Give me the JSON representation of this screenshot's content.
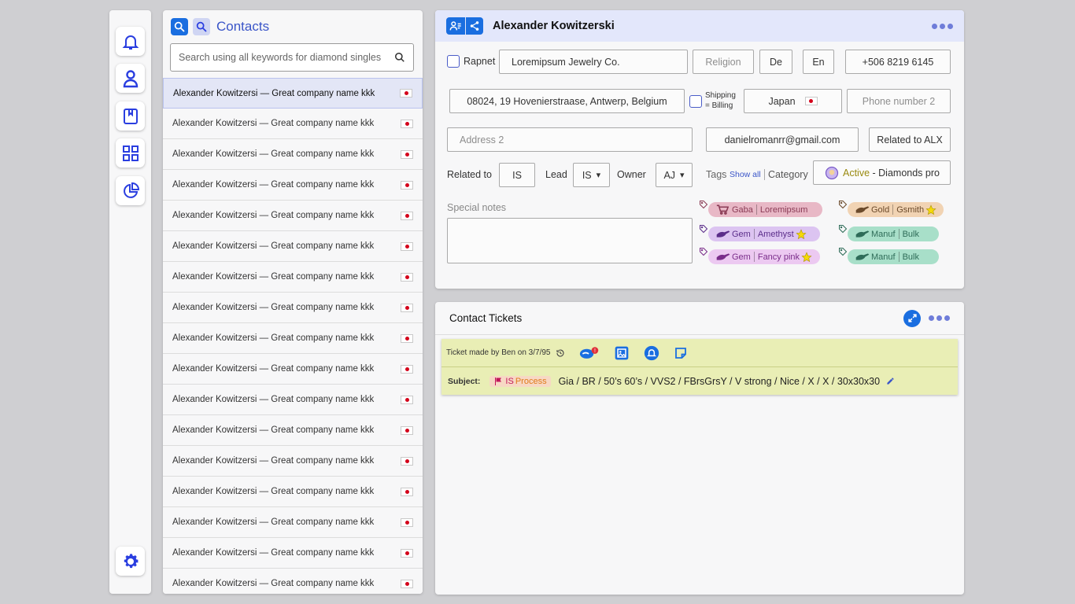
{
  "contacts": {
    "title": "Contacts",
    "search_placeholder": "Search using all keywords for diamond singles",
    "items": [
      {
        "label": "Alexander Kowitzersi — Great company name kkk"
      },
      {
        "label": "Alexander Kowitzersi — Great company name kkk"
      },
      {
        "label": "Alexander Kowitzersi — Great company name kkk"
      },
      {
        "label": "Alexander Kowitzersi — Great company name kkk"
      },
      {
        "label": "Alexander Kowitzersi — Great company name kkk"
      },
      {
        "label": "Alexander Kowitzersi — Great company name kkk"
      },
      {
        "label": "Alexander Kowitzersi — Great company name kkk"
      },
      {
        "label": "Alexander Kowitzersi — Great company name kkk"
      },
      {
        "label": "Alexander Kowitzersi — Great company name kkk"
      },
      {
        "label": "Alexander Kowitzersi — Great company name kkk"
      },
      {
        "label": "Alexander Kowitzersi — Great company name kkk"
      },
      {
        "label": "Alexander Kowitzersi — Great company name kkk"
      },
      {
        "label": "Alexander Kowitzersi — Great company name kkk"
      },
      {
        "label": "Alexander Kowitzersi — Great company name kkk"
      },
      {
        "label": "Alexander Kowitzersi — Great company name kkk"
      },
      {
        "label": "Alexander Kowitzersi — Great company name kkk"
      },
      {
        "label": "Alexander Kowitzersi — Great company name kkk"
      }
    ],
    "selected_index": 0
  },
  "contact": {
    "name": "Alexander Kowitzerski",
    "rapnet_label": "Rapnet",
    "company": "Loremipsum Jewelry Co.",
    "religion_placeholder": "Religion",
    "lang1": "De",
    "lang2": "En",
    "phone": "+506 8219 6145",
    "address": "08024, 19 Hovenierstraase, Antwerp, Belgium",
    "shipping_label_1": "Shipping",
    "shipping_label_2": "= Billing",
    "country": "Japan",
    "phone2_placeholder": "Phone number 2",
    "address2_placeholder": "Address 2",
    "email": "danielromanrr@gmail.com",
    "related_alx": "Related to ALX",
    "related_label": "Related to",
    "related_value": "IS",
    "lead_label": "Lead",
    "lead_value": "IS",
    "owner_label": "Owner",
    "owner_value": "AJ",
    "tags_label": "Tags",
    "show_all": "Show all",
    "category_label": "Category",
    "category_status": "Active",
    "category_dash": " - ",
    "category_value": "Diamonds pro",
    "notes_label": "Special notes",
    "tags": [
      {
        "a": "Gaba",
        "b": "Loremipsum",
        "bg": "#e8b8c6",
        "fg": "#8a3b55",
        "icon": "cart-icon",
        "star": false
      },
      {
        "a": "Gold",
        "b": "Gsmith",
        "bg": "#f1d3b3",
        "fg": "#6b4a2b",
        "icon": "hand-icon",
        "star": true
      },
      {
        "a": "Gem",
        "b": "Amethyst",
        "bg": "#dcc4f1",
        "fg": "#5b2d8a",
        "icon": "hand-icon",
        "star": true
      },
      {
        "a": "Manuf",
        "b": "Bulk",
        "bg": "#a8dfc9",
        "fg": "#2e6c58",
        "icon": "hand-icon",
        "star": false
      },
      {
        "a": "Gem",
        "b": "Fancy pink",
        "bg": "#ecc9f1",
        "fg": "#7a2d8a",
        "icon": "hand-icon",
        "star": true
      },
      {
        "a": "Manuf",
        "b": "Bulk",
        "bg": "#a8dfc9",
        "fg": "#2e6c58",
        "icon": "hand-icon",
        "star": false
      }
    ]
  },
  "tickets": {
    "title": "Contact Tickets",
    "ticket": {
      "made_by": "Ticket made by Ben on 3/7/95",
      "subject_label": "Subject:",
      "status_team": "IS",
      "status_stage": "Process",
      "subject": "Gia / BR / 50’s 60’s / VVS2 / FBrsGrsY / V strong / Nice / X / X / 30x30x30"
    }
  },
  "colors": {
    "accent": "#3a55c8",
    "icon_blue": "#1a6ee0",
    "header_bg": "#e3e7fb",
    "ticket_bg": "#e9eeb5",
    "flag_red": "#d4001a"
  }
}
